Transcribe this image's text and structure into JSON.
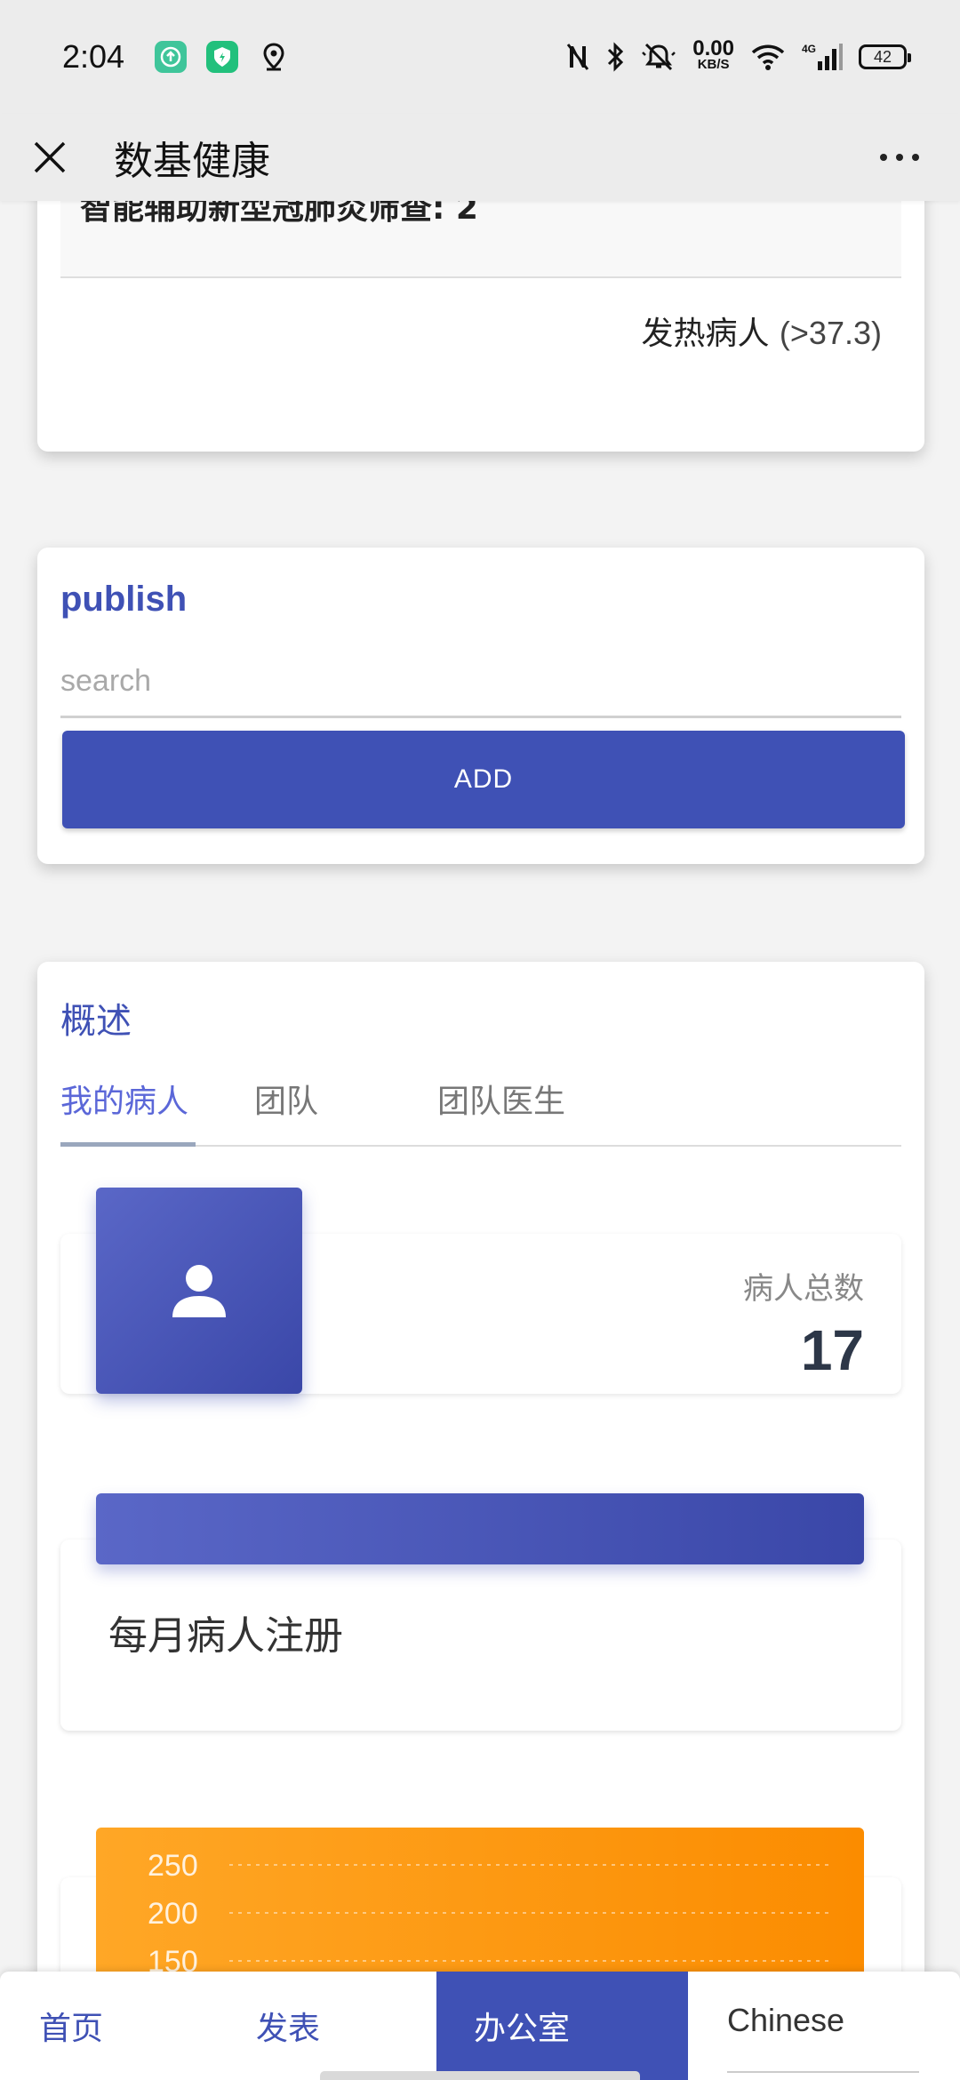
{
  "status_bar": {
    "time": "2:04",
    "net_speed_value": "0.00",
    "net_speed_unit": "KB/S",
    "network_type": "4G",
    "battery": "42"
  },
  "header": {
    "title": "数基健康"
  },
  "screening": {
    "label": "智能辅助新型冠肺炎筛查: 2",
    "fever_label": "发热病人",
    "fever_threshold": "(>37.3)"
  },
  "publish": {
    "title": "publish",
    "search_placeholder": "search",
    "add_label": "ADD"
  },
  "overview": {
    "title": "概述",
    "tabs": [
      {
        "label": "我的病人",
        "active": true
      },
      {
        "label": "团队",
        "active": false
      },
      {
        "label": "团队医生",
        "active": false
      }
    ],
    "patient_total_label": "病人总数",
    "patient_total_value": "17",
    "monthly_registration_title": "每月病人注册"
  },
  "chart_data": {
    "type": "line",
    "y_ticks": [
      "250",
      "200",
      "150"
    ],
    "colors": {
      "background_start": "#ffa726",
      "background_end": "#fb8c00"
    }
  },
  "bottom_nav": {
    "items": [
      {
        "label": "首页",
        "active": false
      },
      {
        "label": "发表",
        "active": false
      },
      {
        "label": "办公室",
        "active": true
      }
    ],
    "language": "Chinese"
  },
  "colors": {
    "primary": "#3f51b5",
    "accent_orange": "#fb8c00",
    "background": "#f3f3f3"
  }
}
